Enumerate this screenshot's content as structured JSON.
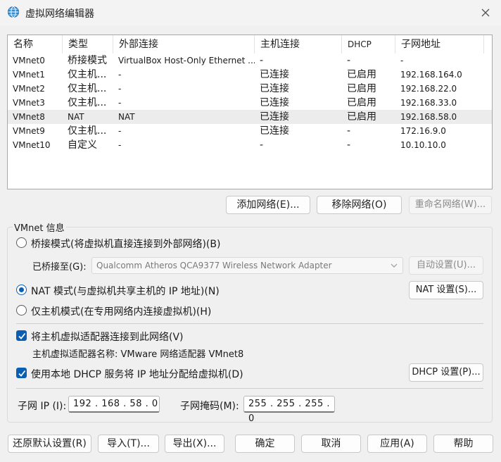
{
  "window": {
    "title": "虚拟网络编辑器"
  },
  "table": {
    "columns": [
      "名称",
      "类型",
      "外部连接",
      "主机连接",
      "DHCP",
      "子网地址"
    ],
    "rows": [
      [
        "VMnet0",
        "桥接模式",
        "VirtualBox Host-Only Ethernet ...",
        "-",
        "-",
        "-"
      ],
      [
        "VMnet1",
        "仅主机...",
        "-",
        "已连接",
        "已启用",
        "192.168.164.0"
      ],
      [
        "VMnet2",
        "仅主机...",
        "-",
        "已连接",
        "已启用",
        "192.168.22.0"
      ],
      [
        "VMnet3",
        "仅主机...",
        "-",
        "已连接",
        "已启用",
        "192.168.33.0"
      ],
      [
        "VMnet8",
        "NAT",
        "NAT",
        "已连接",
        "已启用",
        "192.168.58.0"
      ],
      [
        "VMnet9",
        "仅主机...",
        "-",
        "已连接",
        "-",
        "172.16.9.0"
      ],
      [
        "VMnet10",
        "自定义",
        "-",
        "-",
        "-",
        "10.10.10.0"
      ]
    ],
    "selected_row": 4
  },
  "net_buttons": {
    "add": "添加网络(E)...",
    "remove": "移除网络(O)",
    "rename": "重命名网络(W)..."
  },
  "vmnet_info": {
    "label": "VMnet 信息",
    "bridge_mode": "桥接模式(将虚拟机直接连接到外部网络)(B)",
    "bridged_to_label": "已桥接至(G):",
    "bridged_to_value": "Qualcomm Atheros QCA9377 Wireless Network Adapter",
    "auto_settings": "自动设置(U)...",
    "nat_mode": "NAT 模式(与虚拟机共享主机的 IP 地址)(N)",
    "nat_settings": "NAT 设置(S)...",
    "host_only_mode": "仅主机模式(在专用网络内连接虚拟机)(H)",
    "selected_mode": "nat",
    "connect_adapter": "将主机虚拟适配器连接到此网络(V)",
    "adapter_name": "主机虚拟适配器名称: VMware 网络适配器 VMnet8",
    "use_dhcp": "使用本地 DHCP 服务将 IP 地址分配给虚拟机(D)",
    "dhcp_settings": "DHCP 设置(P)...",
    "subnet_ip_label": "子网 IP (I):",
    "subnet_ip_value": "192 . 168 . 58 . 0",
    "subnet_mask_label": "子网掩码(M):",
    "subnet_mask_value": "255 . 255 . 255 . 0"
  },
  "footer": {
    "restore": "还原默认设置(R)",
    "import": "导入(T)...",
    "export": "导出(X)...",
    "ok": "确定",
    "cancel": "取消",
    "apply": "应用(A)",
    "help": "帮助"
  },
  "colors": {
    "accent": "#0a5fb4",
    "selected_row": "#ececec"
  }
}
